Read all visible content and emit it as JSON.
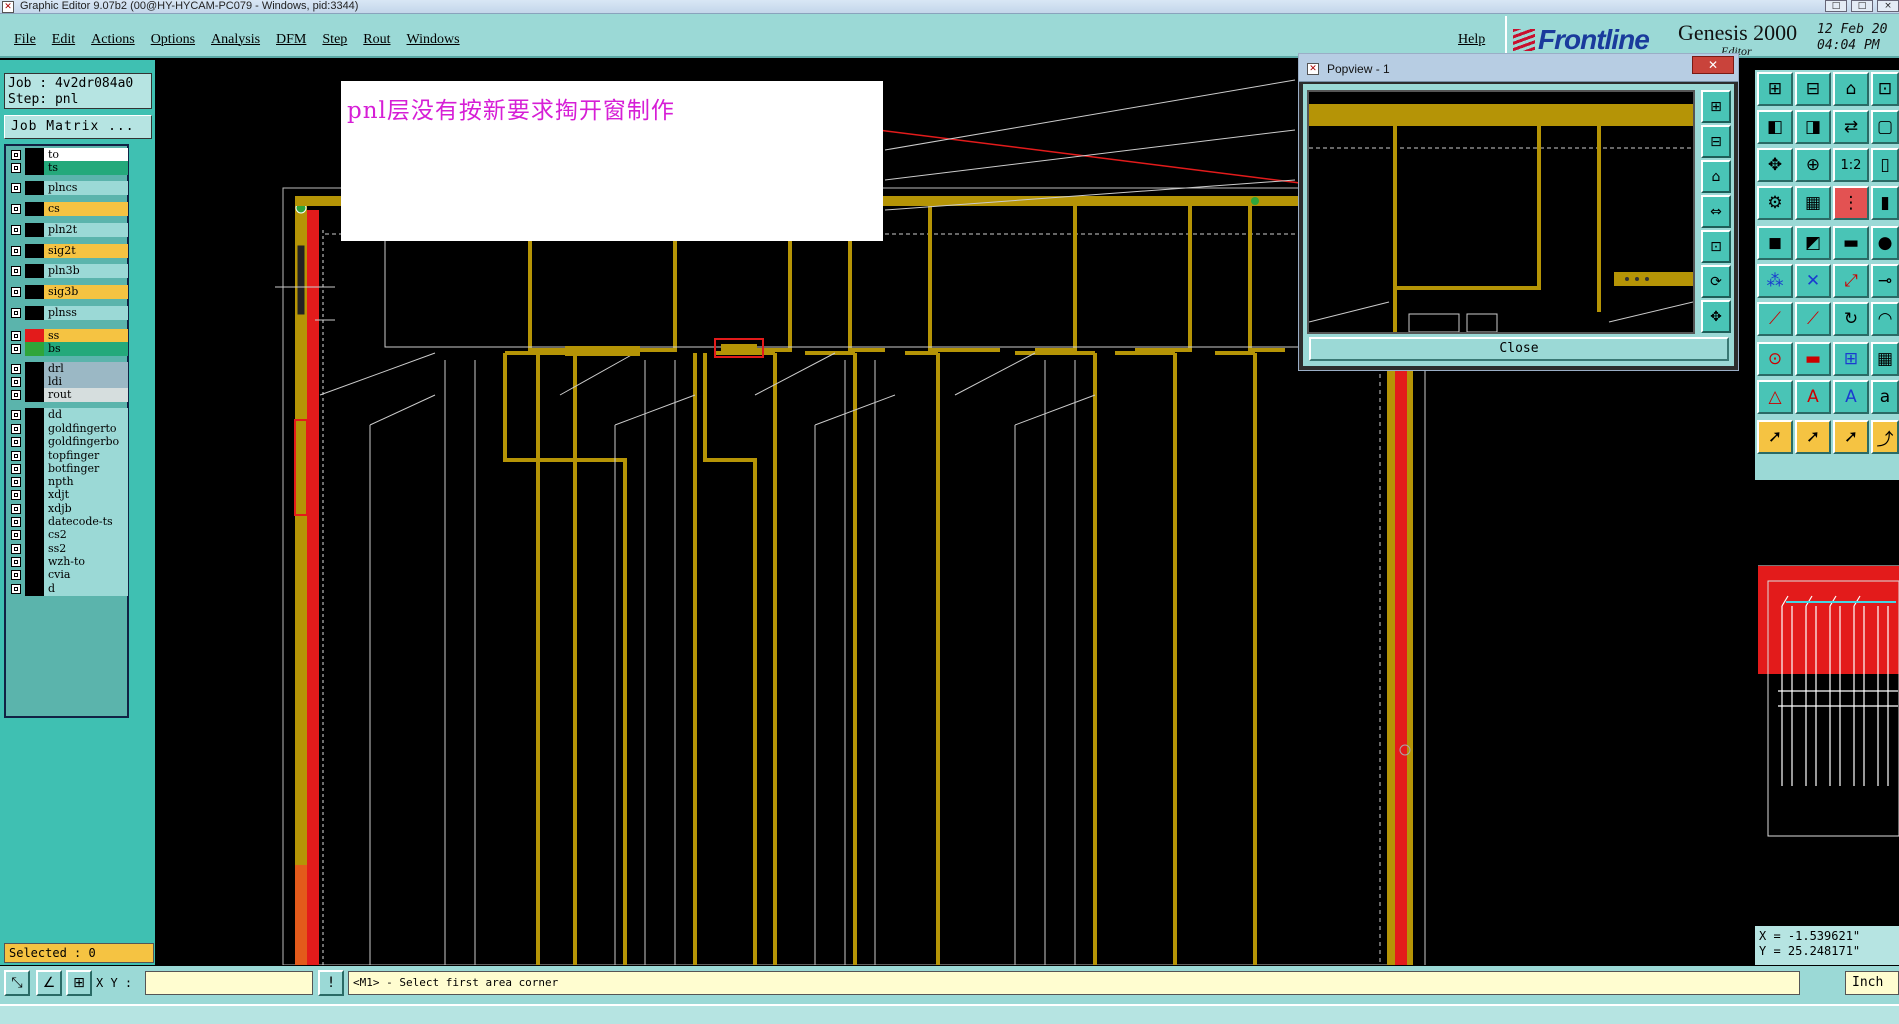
{
  "window": {
    "title": "Graphic Editor 9.07b2 (00@HY-HYCAM-PC079 - Windows, pid:3344)",
    "controls": [
      "□",
      "□",
      "×"
    ]
  },
  "menu": {
    "items": [
      "File",
      "Edit",
      "Actions",
      "Options",
      "Analysis",
      "DFM",
      "Step",
      "Rout",
      "Windows"
    ],
    "help": "Help"
  },
  "brand": {
    "logo_text": "Frontline",
    "product": "Genesis 2000",
    "subtitle": "Editor",
    "date": "12 Feb 20\n04:04 PM"
  },
  "job": {
    "job_line": "Job : 4v2dr084a0",
    "step_line": "Step: pnl",
    "matrix_button": "Job Matrix ..."
  },
  "layers": [
    {
      "name": "to",
      "color": "#ffffff",
      "swatch": "#000000"
    },
    {
      "name": "ts",
      "color": "#24a97b",
      "swatch": "#000000"
    },
    {
      "name": "plncs",
      "color": "#9bd9d6",
      "swatch": "#000000"
    },
    {
      "name": "cs",
      "color": "#f5c342",
      "swatch": "#000000"
    },
    {
      "name": "pln2t",
      "color": "#9bd9d6",
      "swatch": "#000000"
    },
    {
      "name": "sig2t",
      "color": "#f5c342",
      "swatch": "#000000"
    },
    {
      "name": "pln3b",
      "color": "#9bd9d6",
      "swatch": "#000000"
    },
    {
      "name": "sig3b",
      "color": "#f5c342",
      "swatch": "#000000"
    },
    {
      "name": "plnss",
      "color": "#9bd9d6",
      "swatch": "#000000"
    },
    {
      "name": "ss",
      "color": "#f5c342",
      "swatch": "#e31b1b"
    },
    {
      "name": "bs",
      "color": "#24a97b",
      "swatch": "#2fa53a"
    },
    {
      "name": "drl",
      "color": "#9bb8c5",
      "swatch": "#000000"
    },
    {
      "name": "ldi",
      "color": "#9bb8c5",
      "swatch": "#000000"
    },
    {
      "name": "rout",
      "color": "#d6dede",
      "swatch": "#000000"
    },
    {
      "name": "dd",
      "color": "#9bd9d6",
      "swatch": "#000000"
    },
    {
      "name": "goldfingerto",
      "color": "#9bd9d6",
      "swatch": "#000000"
    },
    {
      "name": "goldfingerbo",
      "color": "#9bd9d6",
      "swatch": "#000000"
    },
    {
      "name": "topfinger",
      "color": "#9bd9d6",
      "swatch": "#000000"
    },
    {
      "name": "botfinger",
      "color": "#9bd9d6",
      "swatch": "#000000"
    },
    {
      "name": "npth",
      "color": "#9bd9d6",
      "swatch": "#000000"
    },
    {
      "name": "xdjt",
      "color": "#9bd9d6",
      "swatch": "#000000"
    },
    {
      "name": "xdjb",
      "color": "#9bd9d6",
      "swatch": "#000000"
    },
    {
      "name": "datecode-ts",
      "color": "#9bd9d6",
      "swatch": "#000000"
    },
    {
      "name": "cs2",
      "color": "#9bd9d6",
      "swatch": "#000000"
    },
    {
      "name": "ss2",
      "color": "#9bd9d6",
      "swatch": "#000000"
    },
    {
      "name": "wzh-to",
      "color": "#9bd9d6",
      "swatch": "#000000"
    },
    {
      "name": "cvia",
      "color": "#9bd9d6",
      "swatch": "#000000"
    },
    {
      "name": "d",
      "color": "#9bd9d6",
      "swatch": "#000000"
    }
  ],
  "selected": "Selected : 0",
  "annotation": {
    "text": "pnl层没有按新要求掏开窗制作"
  },
  "popview": {
    "title": "Popview - 1",
    "close_label": "Close"
  },
  "status": {
    "xy_label": "X Y :",
    "xy_value": "",
    "prompt": "<M1> - Select first area corner",
    "units": "Inch"
  },
  "coordinates": "X = -1.539621\"\nY = 25.248171\""
}
